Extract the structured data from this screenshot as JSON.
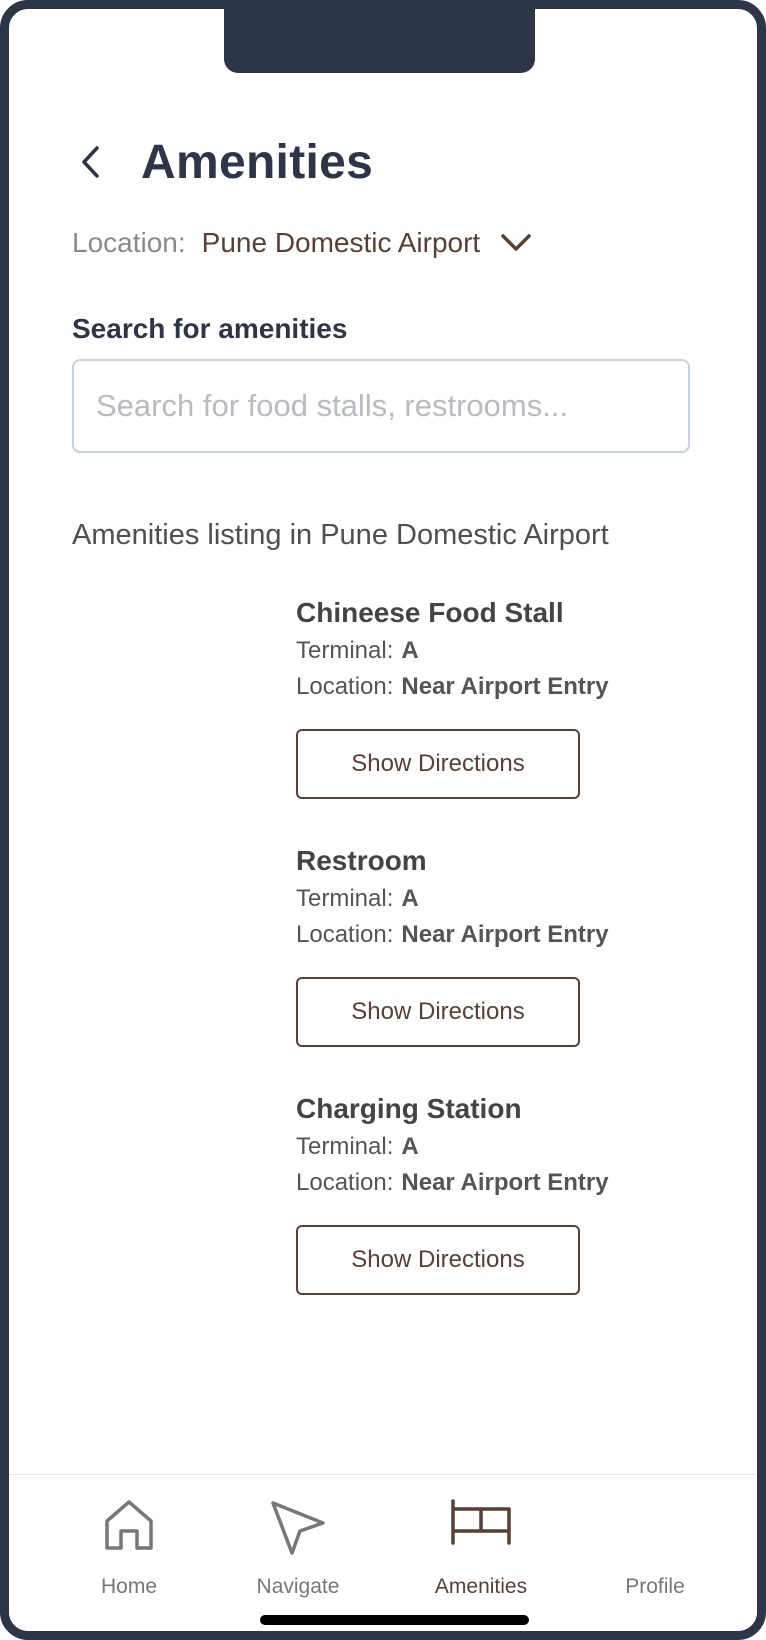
{
  "header": {
    "title": "Amenities",
    "back_icon": "chevron-left-icon"
  },
  "location": {
    "label": "Location:",
    "value": "Pune Domestic Airport",
    "dropdown_icon": "chevron-down-icon"
  },
  "search": {
    "label": "Search for amenities",
    "placeholder": "Search for food stalls, restrooms...",
    "value": ""
  },
  "listing": {
    "heading": "Amenities listing in Pune Domestic Airport",
    "items": [
      {
        "name": "Chineese Food Stall",
        "terminal_label": "Terminal:",
        "terminal": "A",
        "location_label": "Location:",
        "location": "Near Airport Entry",
        "button_label": "Show Directions"
      },
      {
        "name": "Restroom",
        "terminal_label": "Terminal:",
        "terminal": "A",
        "location_label": "Location:",
        "location": "Near Airport Entry",
        "button_label": "Show Directions"
      },
      {
        "name": "Charging Station",
        "terminal_label": "Terminal:",
        "terminal": "A",
        "location_label": "Location:",
        "location": "Near Airport Entry",
        "button_label": "Show Directions"
      }
    ]
  },
  "tabs": [
    {
      "label": "Home",
      "icon": "home-icon",
      "active": false
    },
    {
      "label": "Navigate",
      "icon": "navigate-arrow-icon",
      "active": false
    },
    {
      "label": "Amenities",
      "icon": "bed-icon",
      "active": true
    },
    {
      "label": "Profile",
      "icon": "",
      "active": false
    }
  ],
  "colors": {
    "primary_dark": "#2d3648",
    "accent_brown": "#5a3f32",
    "muted_text": "#8a8a8a",
    "input_border": "#c8d1dd"
  }
}
